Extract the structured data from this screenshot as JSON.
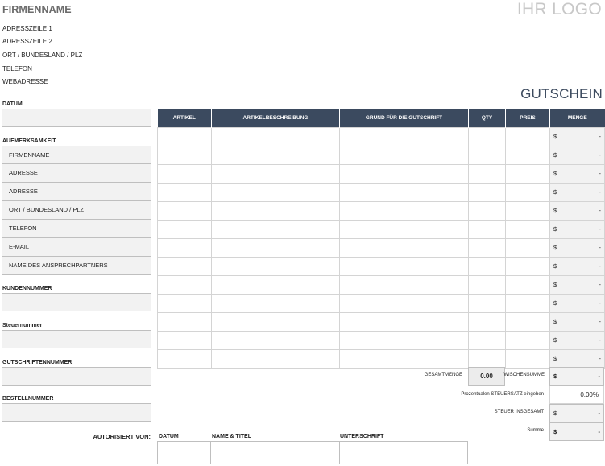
{
  "header": {
    "company": "FIRMENNAME",
    "logo": "IHR LOGO",
    "address": [
      "ADRESSZEILE 1",
      "ADRESSZEILE 2",
      "ORT / BUNDESLAND / PLZ",
      "TELEFON",
      "WEBADRESSE"
    ],
    "title": "GUTSCHEIN"
  },
  "left": {
    "date_label": "DATUM",
    "date_value": "",
    "attention_label": "AUFMERKSAMKEIT",
    "attention_rows": [
      "FIRMENNAME",
      "ADRESSE",
      "ADRESSE",
      "ORT / BUNDESLAND / PLZ",
      "TELEFON",
      "E-MAIL",
      "NAME DES ANSPRECHPARTNERS"
    ],
    "customer_no_label": "KUNDENNUMMER",
    "customer_no_value": "",
    "tax_no_label": "Steuernummer",
    "tax_no_value": "",
    "credit_no_label": "GUTSCHRIFTENNUMMER",
    "credit_no_value": "",
    "order_no_label": "BESTELLNUMMER",
    "order_no_value": ""
  },
  "table": {
    "headers": [
      "ARTIKEL",
      "ARTIKELBESCHREIBUNG",
      "GRUND FÜR DIE GUTSCHRIFT",
      "QTY",
      "PREIS",
      "MENGE"
    ],
    "currency": "$",
    "rows": [
      {
        "artikel": "",
        "beschreibung": "",
        "grund": "",
        "qty": "",
        "preis": "",
        "menge": "-"
      },
      {
        "artikel": "",
        "beschreibung": "",
        "grund": "",
        "qty": "",
        "preis": "",
        "menge": "-"
      },
      {
        "artikel": "",
        "beschreibung": "",
        "grund": "",
        "qty": "",
        "preis": "",
        "menge": "-"
      },
      {
        "artikel": "",
        "beschreibung": "",
        "grund": "",
        "qty": "",
        "preis": "",
        "menge": "-"
      },
      {
        "artikel": "",
        "beschreibung": "",
        "grund": "",
        "qty": "",
        "preis": "",
        "menge": "-"
      },
      {
        "artikel": "",
        "beschreibung": "",
        "grund": "",
        "qty": "",
        "preis": "",
        "menge": "-"
      },
      {
        "artikel": "",
        "beschreibung": "",
        "grund": "",
        "qty": "",
        "preis": "",
        "menge": "-"
      },
      {
        "artikel": "",
        "beschreibung": "",
        "grund": "",
        "qty": "",
        "preis": "",
        "menge": "-"
      },
      {
        "artikel": "",
        "beschreibung": "",
        "grund": "",
        "qty": "",
        "preis": "",
        "menge": "-"
      },
      {
        "artikel": "",
        "beschreibung": "",
        "grund": "",
        "qty": "",
        "preis": "",
        "menge": "-"
      },
      {
        "artikel": "",
        "beschreibung": "",
        "grund": "",
        "qty": "",
        "preis": "",
        "menge": "-"
      },
      {
        "artikel": "",
        "beschreibung": "",
        "grund": "",
        "qty": "",
        "preis": "",
        "menge": "-"
      },
      {
        "artikel": "",
        "beschreibung": "",
        "grund": "",
        "qty": "",
        "preis": "",
        "menge": "-"
      }
    ]
  },
  "totals": {
    "total_qty_label": "GESAMTMENGE",
    "total_qty_value": "0.00",
    "subtotal_label": "WISCHENSUMME",
    "subtotal_value": "-",
    "tax_rate_label": "Prozentualen STEUERSATZ eingeben",
    "tax_rate_value": "0.00%",
    "tax_total_label": "STEUER INSGESAMT",
    "tax_total_value": "-",
    "sum_label": "Summe",
    "sum_value": "-"
  },
  "authorized": {
    "label": "AUTORISIERT VON:",
    "date_label": "DATUM",
    "name_label": "NAME & TITEL",
    "signature_label": "UNTERSCHRIFT"
  },
  "colors": {
    "header_bg": "#3b4a5f",
    "field_bg": "#f2f2f2",
    "logo": "#c8c8c8",
    "title": "#3c4a5e"
  }
}
